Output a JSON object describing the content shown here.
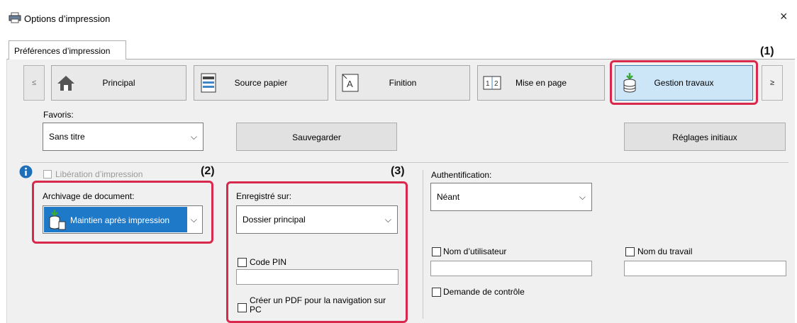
{
  "window": {
    "title": "Options d’impression",
    "close_glyph": "×"
  },
  "tab": {
    "label": "Préférences d’impression"
  },
  "toolbar": {
    "prev": "≤",
    "next": "≥",
    "buttons": [
      {
        "label": "Principal",
        "icon": "home-icon"
      },
      {
        "label": "Source papier",
        "icon": "paper-tray-icon"
      },
      {
        "label": "Finition",
        "icon": "finishing-icon"
      },
      {
        "label": "Mise en page",
        "icon": "layout-icon"
      },
      {
        "label": "Gestion travaux",
        "icon": "job-storage-icon",
        "active": true
      }
    ]
  },
  "favorites": {
    "label": "Favoris:",
    "value": "Sans titre",
    "save_button": "Sauvegarder",
    "defaults_button": "Réglages initiaux"
  },
  "release": {
    "label": "Libération d’impression",
    "info_icon": "info-icon"
  },
  "archive": {
    "label": "Archivage de document:",
    "value": "Maintien après impression"
  },
  "stored_on": {
    "label": "Enregistré sur:",
    "value": "Dossier principal",
    "pin_label": "Code PIN",
    "pdf_label_line1": "Créer un PDF pour la navigation sur",
    "pdf_label_line2": "PC"
  },
  "auth": {
    "label": "Authentification:",
    "value": "Néant",
    "username_label": "Nom d’utilisateur",
    "jobname_label": "Nom du travail",
    "confirm_label": "Demande de contrôle"
  },
  "callouts": {
    "c1": "(1)",
    "c2": "(2)",
    "c3": "(3)"
  },
  "colors": {
    "highlight": "#d8294c",
    "active_bg": "#cde6f7",
    "archive_bg": "#1e79c9"
  }
}
